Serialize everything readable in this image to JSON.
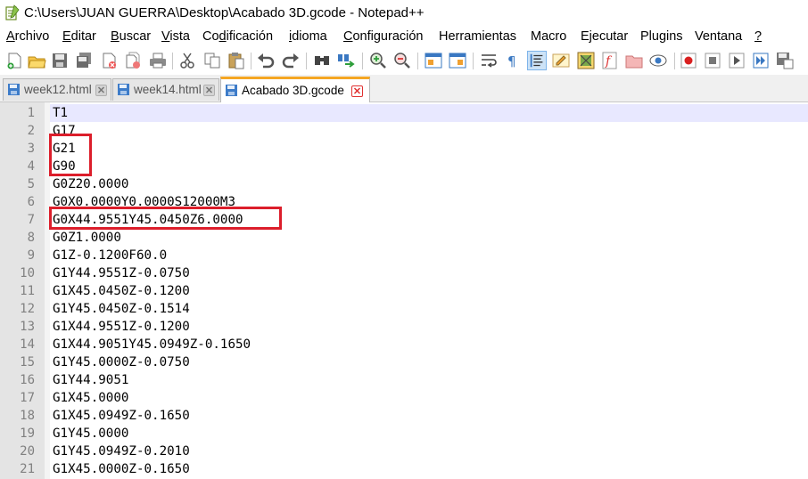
{
  "window": {
    "title": "C:\\Users\\JUAN GUERRA\\Desktop\\Acabado 3D.gcode - Notepad++"
  },
  "menu": {
    "items": [
      {
        "accel": "A",
        "rest": "rchivo"
      },
      {
        "accel": "E",
        "rest": "ditar"
      },
      {
        "accel": "B",
        "rest": "uscar"
      },
      {
        "accel": "V",
        "rest": "ista"
      },
      {
        "pre": "Co",
        "accel": "d",
        "rest": "ificación"
      },
      {
        "accel": "i",
        "rest": "dioma"
      },
      {
        "accel": "C",
        "rest": "onfiguración"
      },
      {
        "accel": "",
        "rest": "Herramientas"
      },
      {
        "accel": "",
        "rest": "Macro"
      },
      {
        "accel": "",
        "rest": "Ejecutar"
      },
      {
        "accel": "",
        "rest": "Plugins"
      },
      {
        "accel": "",
        "rest": "Ventana"
      },
      {
        "accel": "?",
        "rest": ""
      }
    ]
  },
  "tabs": [
    {
      "label": "week12.html",
      "active": false
    },
    {
      "label": "week14.html",
      "active": false
    },
    {
      "label": "Acabado 3D.gcode",
      "active": true
    }
  ],
  "editor": {
    "current_line": 1,
    "lines": [
      {
        "n": "1",
        "text": "T1"
      },
      {
        "n": "2",
        "text": "G17"
      },
      {
        "n": "3",
        "text": "G21"
      },
      {
        "n": "4",
        "text": "G90"
      },
      {
        "n": "5",
        "text": "G0Z20.0000"
      },
      {
        "n": "6",
        "text": "G0X0.0000Y0.0000S12000M3"
      },
      {
        "n": "7",
        "text": "G0X44.9551Y45.0450Z6.0000"
      },
      {
        "n": "8",
        "text": "G0Z1.0000"
      },
      {
        "n": "9",
        "text": "G1Z-0.1200F60.0"
      },
      {
        "n": "10",
        "text": "G1Y44.9551Z-0.0750"
      },
      {
        "n": "11",
        "text": "G1X45.0450Z-0.1200"
      },
      {
        "n": "12",
        "text": "G1Y45.0450Z-0.1514"
      },
      {
        "n": "13",
        "text": "G1X44.9551Z-0.1200"
      },
      {
        "n": "14",
        "text": "G1X44.9051Y45.0949Z-0.1650"
      },
      {
        "n": "15",
        "text": "G1Y45.0000Z-0.0750"
      },
      {
        "n": "16",
        "text": "G1Y44.9051"
      },
      {
        "n": "17",
        "text": "G1X45.0000"
      },
      {
        "n": "18",
        "text": "G1X45.0949Z-0.1650"
      },
      {
        "n": "19",
        "text": "G1Y45.0000"
      },
      {
        "n": "20",
        "text": "G1Y45.0949Z-0.2010"
      },
      {
        "n": "21",
        "text": "G1X45.0000Z-0.1650"
      }
    ]
  },
  "colors": {
    "highlight_box": "#dc1e2b",
    "current_line_bg": "#e8e8ff",
    "active_tab_accent": "#f5a623"
  }
}
